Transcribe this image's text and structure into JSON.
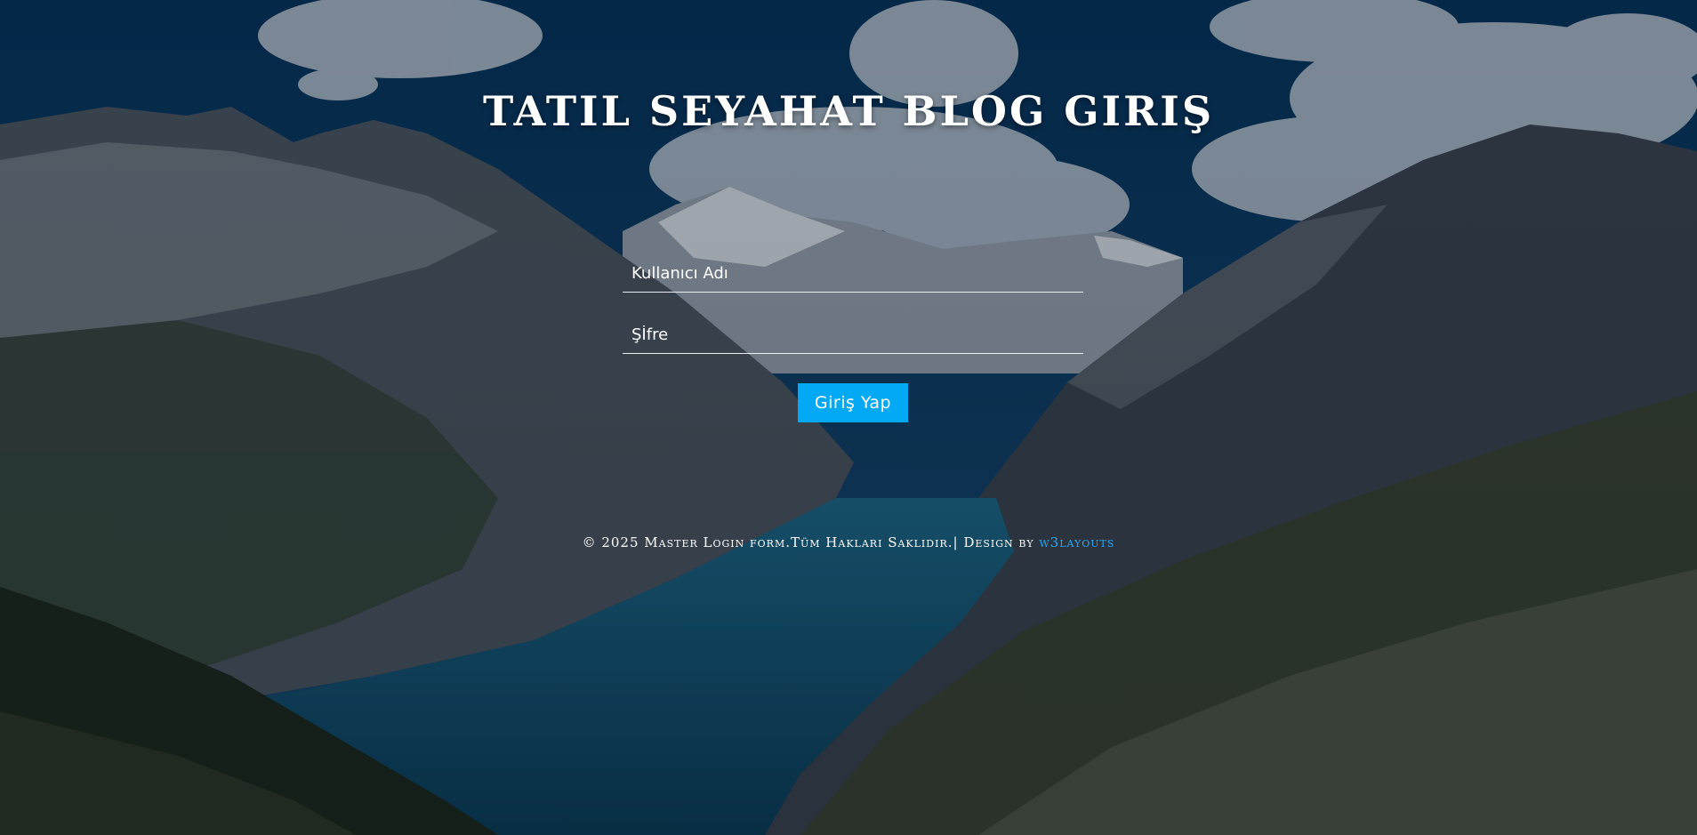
{
  "page": {
    "title": "TATIL SEYAHAT BLOG GIRIŞ"
  },
  "form": {
    "username_placeholder": "Kullanıcı Adı",
    "username_value": "",
    "password_placeholder": "Şİfre",
    "password_value": "",
    "submit_label": "Giriş Yap"
  },
  "footer": {
    "copyright_text": "© 2025 Master Login form.Tüm Hakları Saklıdır.| Design by ",
    "link_text": "w3layouts"
  },
  "colors": {
    "accent": "#03a9f4",
    "link": "#29a9f5",
    "text": "#ffffff"
  },
  "background": {
    "icon": "mountain-lake-landscape"
  }
}
